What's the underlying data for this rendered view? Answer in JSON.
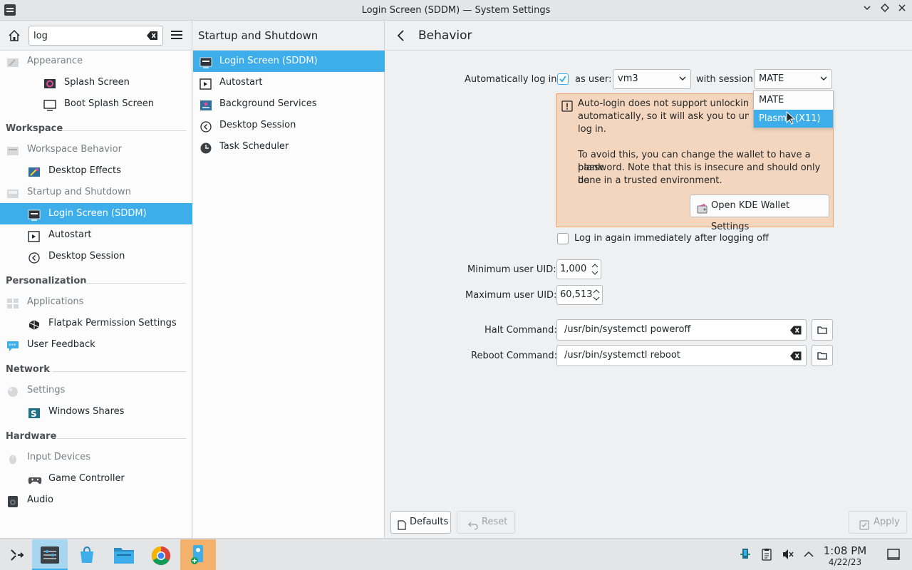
{
  "window": {
    "title": "Login Screen (SDDM) — System Settings"
  },
  "search": {
    "value": "log"
  },
  "sidebar": {
    "items": [
      {
        "label": "Appearance",
        "dim": true,
        "icon": "appearance-icon"
      },
      {
        "label": "Splash Screen",
        "icon": "splash-screen-icon"
      },
      {
        "label": "Boot Splash Screen",
        "icon": "monitor-icon"
      },
      {
        "group": "Workspace"
      },
      {
        "label": "Workspace Behavior",
        "dim": true,
        "icon": "workspace-behavior-icon"
      },
      {
        "label": "Desktop Effects",
        "icon": "desktop-effects-icon"
      },
      {
        "label": "Startup and Shutdown",
        "dim": true,
        "icon": "startup-icon"
      },
      {
        "label": "Login Screen (SDDM)",
        "active": true,
        "icon": "login-screen-icon"
      },
      {
        "label": "Autostart",
        "icon": "autostart-icon"
      },
      {
        "label": "Desktop Session",
        "icon": "desktop-session-icon"
      },
      {
        "group": "Personalization"
      },
      {
        "label": "Applications",
        "dim": true,
        "icon": "applications-icon"
      },
      {
        "label": "Flatpak Permission Settings",
        "icon": "flatpak-icon"
      },
      {
        "label": "User Feedback",
        "icon": "user-feedback-icon"
      },
      {
        "group": "Network"
      },
      {
        "label": "Settings",
        "dim": true,
        "icon": "network-settings-icon"
      },
      {
        "label": "Windows Shares",
        "icon": "windows-shares-icon"
      },
      {
        "group": "Hardware"
      },
      {
        "label": "Input Devices",
        "dim": true,
        "icon": "input-devices-icon"
      },
      {
        "label": "Game Controller",
        "icon": "game-controller-icon"
      },
      {
        "label": "Audio",
        "icon": "audio-icon"
      }
    ]
  },
  "subpanel": {
    "title": "Startup and Shutdown",
    "items": [
      {
        "label": "Login Screen (SDDM)",
        "active": true
      },
      {
        "label": "Autostart"
      },
      {
        "label": "Background Services"
      },
      {
        "label": "Desktop Session"
      },
      {
        "label": "Task Scheduler"
      }
    ]
  },
  "main": {
    "title": "Behavior",
    "autologin_label": "Automatically log in:",
    "autologin_checked": true,
    "as_user_label": "as user:",
    "user_value": "vm3",
    "with_session_label": "with session",
    "session_value": "MATE",
    "session_options": [
      "MATE",
      "Plasma (X11)"
    ],
    "session_highlighted": "Plasma (X11)",
    "warning": {
      "line1": "Auto-login does not support unlocking your KDE wallet",
      "line2": "automatically, so it will ask you to unlock it every time you",
      "line3": "log in.",
      "para2_line1": "To avoid this, you can change the wallet to have a blank",
      "para2_line2": "password. Note that this is insecure and should only be",
      "para2_line3": "done in a trusted environment.",
      "button": "Open KDE Wallet Settings"
    },
    "relogin_label": "Log in again immediately after logging off",
    "relogin_checked": false,
    "min_uid_label": "Minimum user UID:",
    "min_uid_value": "1,000",
    "max_uid_label": "Maximum user UID:",
    "max_uid_value": "60,513",
    "halt_label": "Halt Command:",
    "halt_value": "/usr/bin/systemctl poweroff",
    "reboot_label": "Reboot Command:",
    "reboot_value": "/usr/bin/systemctl reboot",
    "defaults_button": "Defaults",
    "reset_button": "Reset",
    "apply_button": "Apply"
  },
  "taskbar": {
    "apps": [
      "application-launcher-icon",
      "system-settings-icon",
      "discover-store-icon",
      "file-manager-icon",
      "chrome-icon",
      "kde-connect-icon"
    ],
    "time": "1:08 PM",
    "date": "4/22/23"
  },
  "colors": {
    "accent": "#3daee9",
    "warning_bg": "#f3d6bd",
    "warning_border": "#f0a06a"
  }
}
